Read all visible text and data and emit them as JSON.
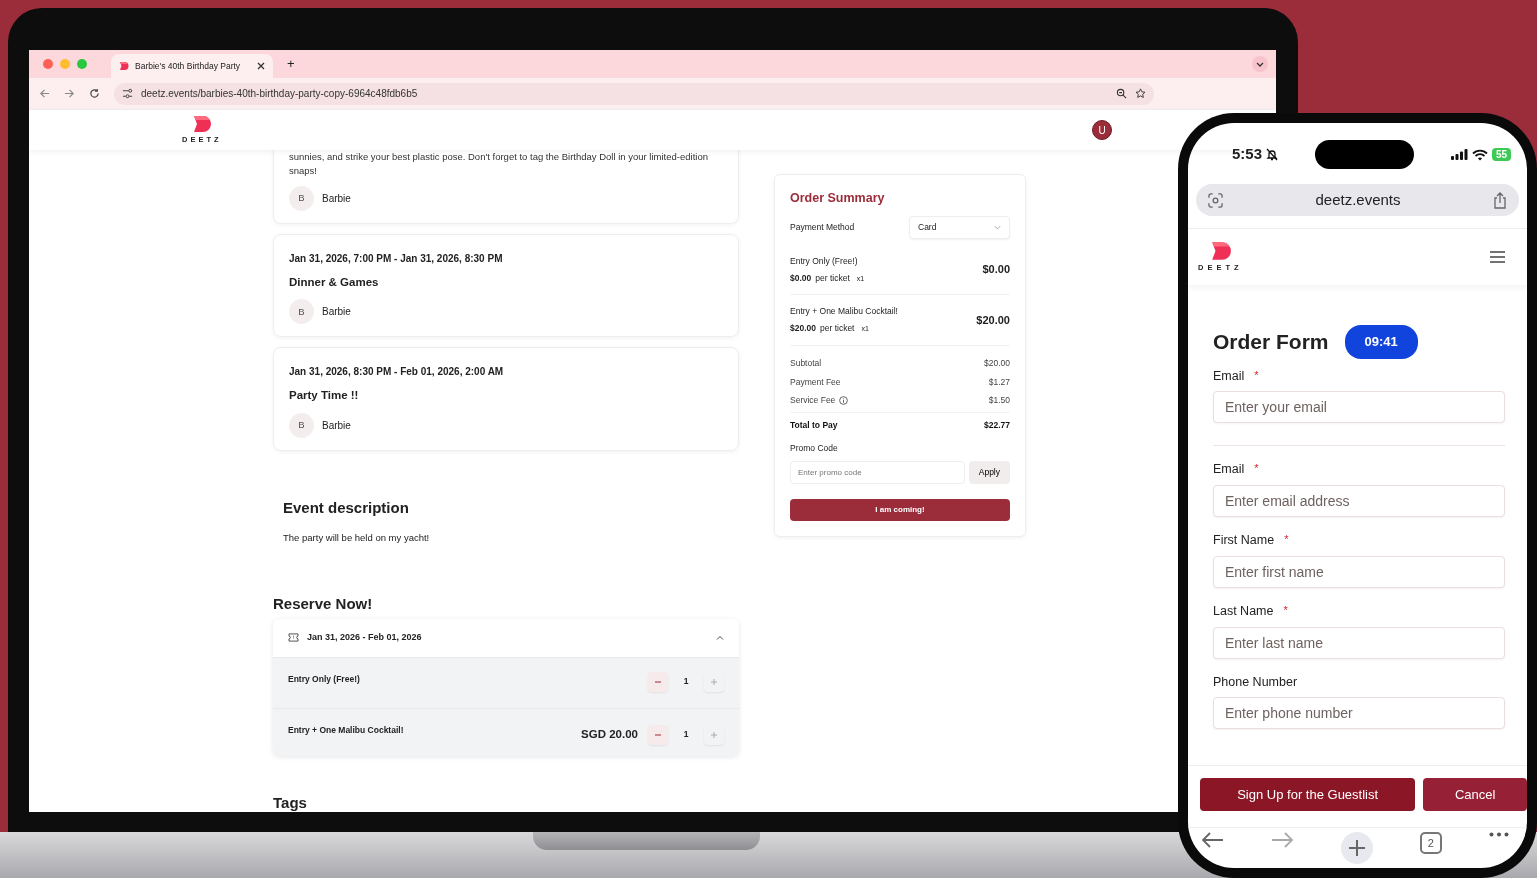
{
  "laptop": {
    "browser": {
      "tab_title": "Barbie's 40th Birthday Party",
      "new_tab": "+",
      "url": "deetz.events/barbies-40th-birthday-party-copy-6964c48fdb6b5"
    },
    "header": {
      "logo_text": "DEETZ",
      "avatar": "U"
    },
    "schedule": [
      {
        "description": "sunnies, and strike your best plastic pose. Don't forget to tag the Birthday Doll in your limited-edition snaps!",
        "host_initial": "B",
        "host": "Barbie"
      },
      {
        "date": "Jan 31, 2026, 7:00 PM - Jan 31, 2026, 8:30 PM",
        "title": "Dinner & Games",
        "host_initial": "B",
        "host": "Barbie"
      },
      {
        "date": "Jan 31, 2026, 8:30 PM - Feb 01, 2026, 2:00 AM",
        "title": "Party Time !!",
        "host_initial": "B",
        "host": "Barbie"
      }
    ],
    "event_description": {
      "heading": "Event description",
      "text": "The party will be held on my yacht!"
    },
    "reserve": {
      "heading": "Reserve Now!",
      "date_range": "Jan 31, 2026 - Feb 01, 2026",
      "expanded": true,
      "tickets": [
        {
          "name": "Entry Only (Free!)",
          "quantity": "1"
        },
        {
          "name": "Entry + One Malibu Cocktail!",
          "price": "SGD 20.00",
          "quantity": "1"
        }
      ]
    },
    "tags_heading": "Tags",
    "order_summary": {
      "title": "Order Summary",
      "payment_method_label": "Payment Method",
      "payment_method": "Card",
      "items": [
        {
          "name": "Entry Only (Free!)",
          "unit_price": "$0.00",
          "unit_label": "per ticket",
          "quantity": "x1",
          "total": "$0.00"
        },
        {
          "name": "Entry + One Malibu Cocktail!",
          "unit_price": "$20.00",
          "unit_label": "per ticket",
          "quantity": "x1",
          "total": "$20.00"
        }
      ],
      "totals": [
        {
          "label": "Subtotal",
          "value": "$20.00",
          "kind": "line",
          "info": false
        },
        {
          "label": "Payment Fee",
          "value": "$1.27",
          "kind": "line",
          "info": false
        },
        {
          "label": "Service Fee",
          "value": "$1.50",
          "kind": "line",
          "info": true
        },
        {
          "label": "Total to Pay",
          "value": "$22.77",
          "kind": "total",
          "info": false
        }
      ],
      "promo_label": "Promo Code",
      "promo_placeholder": "Enter promo code",
      "apply": "Apply",
      "submit": "I am coming!"
    }
  },
  "phone": {
    "time": "5:53",
    "battery": "55",
    "url": "deetz.events",
    "logo_text": "DEETZ",
    "form_title": "Order Form",
    "timer": "09:41",
    "fields": [
      {
        "label": "Email",
        "required_mark": "*",
        "placeholder": "Enter your email",
        "separated": true
      },
      {
        "label": "Email",
        "required_mark": "*",
        "placeholder": "Enter email address",
        "separated": false
      },
      {
        "label": "First Name",
        "required_mark": "*",
        "placeholder": "Enter first name",
        "separated": false
      },
      {
        "label": "Last Name",
        "required_mark": "*",
        "placeholder": "Enter last name",
        "separated": false
      },
      {
        "label": "Phone Number",
        "placeholder": "Enter phone number",
        "separated": false
      }
    ],
    "buttons": [
      {
        "label": "Sign Up for the Guestlist",
        "kind": "primary"
      },
      {
        "label": "Cancel",
        "kind": "secondary"
      }
    ],
    "tab_count": "2"
  }
}
